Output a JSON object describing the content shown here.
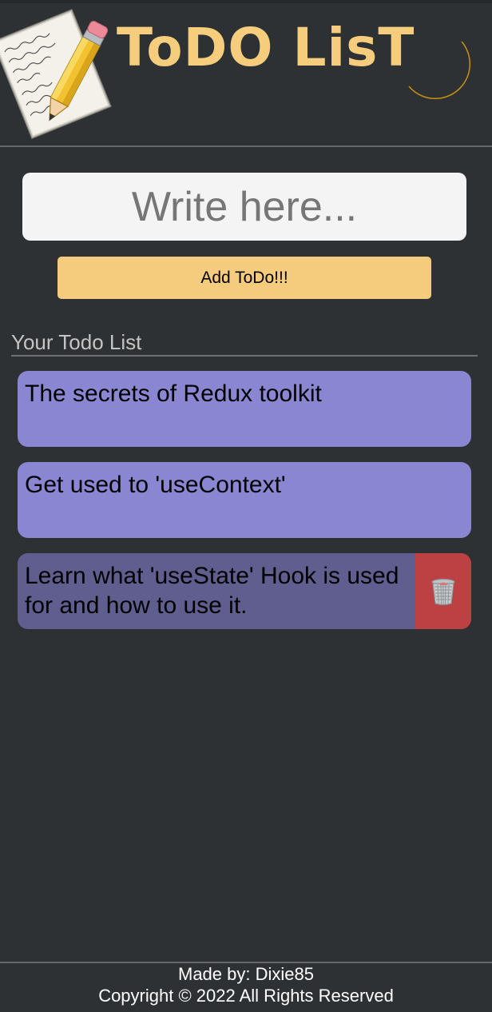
{
  "header": {
    "title": "ToDO LisT",
    "logo_icon": "notepad-pencil-icon",
    "theme_toggle_icon": "crescent-moon-icon"
  },
  "form": {
    "input_placeholder": "Write here...",
    "input_value": "",
    "add_button_label": "Add ToDo!!!"
  },
  "list": {
    "heading": "Your Todo List",
    "items": [
      {
        "text": "The secrets of Redux toolkit",
        "hovered": false
      },
      {
        "text": "Get used to 'useContext'",
        "hovered": false
      },
      {
        "text": "Learn what 'useState' Hook is used for and how to use it.",
        "hovered": true,
        "delete_icon": "trash-can-icon"
      }
    ]
  },
  "footer": {
    "made_by": "Made by: Dixie85",
    "copyright": "Copyright © 2022 All Rights Reserved"
  },
  "colors": {
    "background": "#2d3134",
    "accent": "#f5cb7d",
    "todo_item": "#8b86d2",
    "todo_item_hover": "#5f5e8f",
    "delete": "#bd4142"
  }
}
